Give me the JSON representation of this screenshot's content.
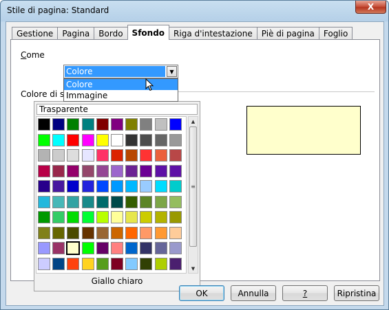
{
  "window": {
    "title": "Stile di pagina: Standard",
    "close_glyph": "X"
  },
  "tabs": [
    {
      "label": "Gestione"
    },
    {
      "label": "Pagina"
    },
    {
      "label": "Bordo"
    },
    {
      "label": "Sfondo",
      "active": true
    },
    {
      "label": "Riga d'intestazione"
    },
    {
      "label": "Piè di pagina"
    },
    {
      "label": "Foglio"
    }
  ],
  "background": {
    "as_label": "Come",
    "as_value": "Colore",
    "options": [
      "Colore",
      "Immagine"
    ],
    "color_label_visible": "Colore di s",
    "transparent_label": "Trasparente",
    "selected_color_name": "Giallo chiaro",
    "preview_color": "#ffffcc"
  },
  "palette": [
    [
      "#000000",
      "#000080",
      "#008000",
      "#008080",
      "#800000",
      "#800080",
      "#808000",
      "#808080",
      "#c0c0c0",
      "#0000ff"
    ],
    [
      "#00ff00",
      "#00ffff",
      "#ff0000",
      "#ff00ff",
      "#ffff00",
      "#ffffff",
      "#333333",
      "#4d4d4d",
      "#666666",
      "#999999"
    ],
    [
      "#b3b3b3",
      "#cccccc",
      "#dddddd",
      "#e6e6ff",
      "#ff3366",
      "#dc2300",
      "#b84700",
      "#ff3333",
      "#eb613d",
      "#b84747"
    ],
    [
      "#b80047",
      "#99284c",
      "#94006b",
      "#94476b",
      "#944794",
      "#9c66cc",
      "#6b2394",
      "#6b0094",
      "#5e11a6",
      "#5e11a6"
    ],
    [
      "#28008b",
      "#47199f",
      "#0000cc",
      "#2323dc",
      "#0047ff",
      "#0099ff",
      "#00b8ff",
      "#99ccff",
      "#00dcff",
      "#00cccc"
    ],
    [
      "#23b8dc",
      "#47b8b8",
      "#33a3a3",
      "#198a8a",
      "#006b6b",
      "#004a4a",
      "#355e00",
      "#5c8526",
      "#7da647",
      "#94bd5e"
    ],
    [
      "#009900",
      "#33cc66",
      "#00dc00",
      "#00ff33",
      "#b8ff00",
      "#ffff99",
      "#e6e64c",
      "#cccc00",
      "#b3b300",
      "#999900"
    ],
    [
      "#808019",
      "#666600",
      "#4c4c00",
      "#663300",
      "#996633",
      "#cc6600",
      "#ff6600",
      "#ff9966",
      "#ff9933",
      "#ffcc99"
    ],
    [
      "#9999ff",
      "#993366",
      "#ffffcc",
      "#00ff00",
      "#660066",
      "#ff8080",
      "#0066cc",
      "#333366",
      "#666699",
      "#9999cc"
    ],
    [
      "#ccccff",
      "#004586",
      "#ff420e",
      "#ffd320",
      "#579d1c",
      "#7e0021",
      "#83caff",
      "#314004",
      "#aecf00",
      "#4b1f6f"
    ]
  ],
  "selected_swatch": [
    8,
    2
  ],
  "buttons": {
    "ok": "OK",
    "cancel": "Annulla",
    "help": "?",
    "reset": "Ripristina"
  }
}
